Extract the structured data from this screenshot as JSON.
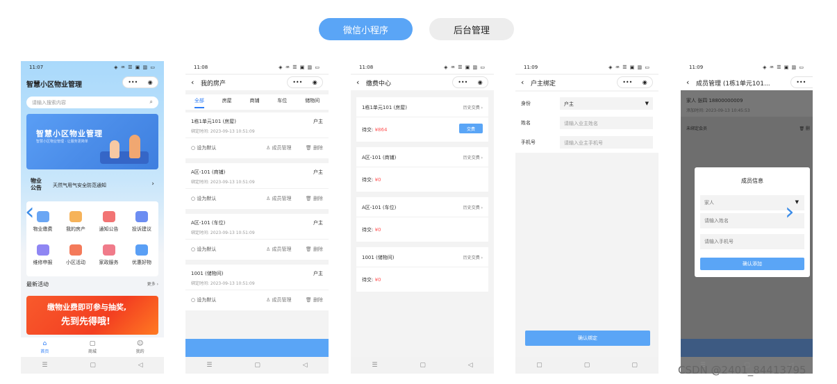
{
  "tabs": {
    "mini_program": "微信小程序",
    "admin": "后台管理"
  },
  "watermark": "CSDN @2401_84413795",
  "status": {
    "p1": "11:07",
    "p2": "11:08",
    "p3": "11:08",
    "p4": "11:09",
    "p5": "11:09",
    "signal": "◈ ♒ ☰ ▣ ▥ ▭"
  },
  "capsule": {
    "dots": "•••",
    "target": "◉"
  },
  "phone1": {
    "title": "智慧小区物业管理",
    "search_placeholder": "请输入搜索内容",
    "search_icon": "⌕",
    "banner_title": "智慧小区物业管理",
    "banner_sub": "智慧小区物业管理 · 让服务更简单",
    "notice_tag": "物业公告",
    "notice_text": "天然气用气安全防范通知",
    "notice_arrow": "›",
    "grid": [
      {
        "label": "物业缴费",
        "color": "#6aa6f4"
      },
      {
        "label": "我的房产",
        "color": "#f6b35a"
      },
      {
        "label": "通知公告",
        "color": "#f27474"
      },
      {
        "label": "投诉建议",
        "color": "#6c8df2"
      },
      {
        "label": "维修申报",
        "color": "#8f86f3"
      },
      {
        "label": "小区活动",
        "color": "#f47a5a"
      },
      {
        "label": "家政服务",
        "color": "#f07b8a"
      },
      {
        "label": "优惠好物",
        "color": "#5a9ff5"
      }
    ],
    "section_title": "最新活动",
    "section_more": "更多 ›",
    "promo_line1": "缴物业费即可参与抽奖,",
    "promo_line2": "先到先得哦!",
    "tabbar": [
      {
        "icon": "⌂",
        "label": "首页"
      },
      {
        "icon": "▢",
        "label": "商城"
      },
      {
        "icon": "☺",
        "label": "我的"
      }
    ]
  },
  "phone2": {
    "title": "我的房产",
    "subtabs": [
      "全部",
      "房屋",
      "商铺",
      "车位",
      "储物间"
    ],
    "cards": [
      {
        "name": "1栋1单元101 (房屋)",
        "role": "户主",
        "time": "绑定时间: 2023-09-13 10:51:09"
      },
      {
        "name": "A区-101 (商铺)",
        "role": "户主",
        "time": "绑定时间: 2023-09-13 10:51:09"
      },
      {
        "name": "A区-101 (车位)",
        "role": "户主",
        "time": "绑定时间: 2023-09-13 10:51:09"
      },
      {
        "name": "1001 (储物间)",
        "role": "户主",
        "time": "绑定时间: 2023-09-13 10:51:09"
      }
    ],
    "default_label": "○ 设为默认",
    "member_label": "♙ 成员管理",
    "delete_label": "🗑 删除"
  },
  "phone3": {
    "title": "缴费中心",
    "history_label": "历史交费 ›",
    "due_label": "待交:",
    "pay_button": "交费",
    "items": [
      {
        "name": "1栋1单元101 (房屋)",
        "amount": "¥864"
      },
      {
        "name": "A区-101 (商铺)",
        "amount": "¥0"
      },
      {
        "name": "A区-101 (车位)",
        "amount": "¥0"
      },
      {
        "name": "1001 (储物间)",
        "amount": "¥0"
      }
    ]
  },
  "phone4": {
    "title": "户主绑定",
    "identity_label": "身份",
    "identity_value": "户主",
    "name_label": "姓名",
    "name_placeholder": "请输入业主姓名",
    "phone_label": "手机号",
    "phone_placeholder": "请输入业主手机号",
    "confirm_button": "确认绑定"
  },
  "phone5": {
    "title": "成员管理 (1栋1单元101...",
    "member_line": "家人  张四  18800000009",
    "member_time": "添加时间: 2023-09-13 10:45:53",
    "unbound": "未绑定会员",
    "delete": "🗑 删",
    "modal_title": "成员信息",
    "relation": "家人",
    "name_placeholder": "请输入姓名",
    "phone_placeholder": "请输入手机号",
    "add_button": "确认添加"
  },
  "arrows": {
    "left": "‹",
    "right": "›"
  },
  "sys_nav": {
    "menu": "☰",
    "home": "▢",
    "back": "◁"
  }
}
